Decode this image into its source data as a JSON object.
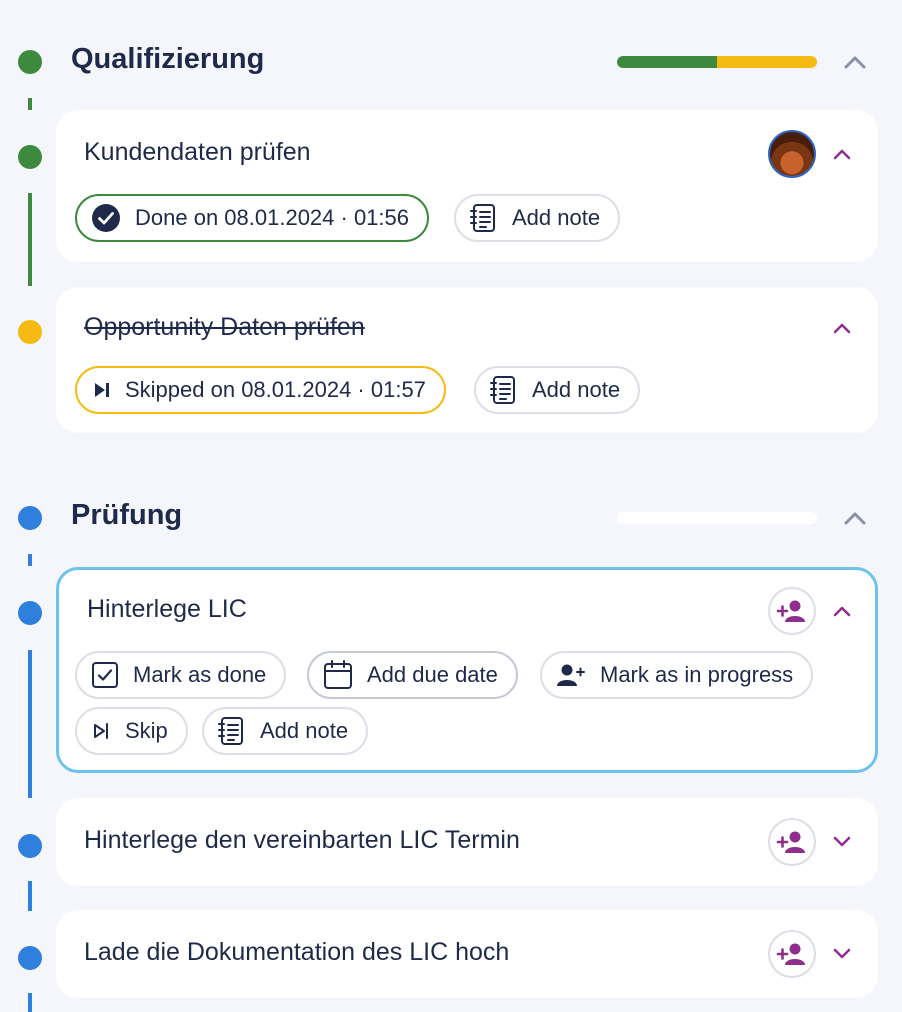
{
  "colors": {
    "green": "#3d8a3e",
    "yellow": "#f6bb12",
    "blue": "#2f7fdc",
    "purple": "#8e2f8e",
    "active_border": "#6ec3ec",
    "text": "#1f2a4a"
  },
  "sections": [
    {
      "title": "Qualifizierung",
      "status_color": "green",
      "progress": {
        "done_fraction": 0.5,
        "skipped_fraction": 0.5
      },
      "collapse_icon": "chevron-up-icon",
      "tasks": [
        {
          "title": "Kundendaten prüfen",
          "assignee": "avatar",
          "status_color": "green",
          "expanded": true,
          "chips": [
            {
              "icon": "check-circle-icon",
              "label": "Done on 08.01.2024 · 01:56"
            },
            {
              "icon": "note-icon",
              "label": "Add note"
            }
          ]
        },
        {
          "title": "Opportunity Daten prüfen",
          "status_color": "yellow",
          "strikethrough": true,
          "expanded": true,
          "chips": [
            {
              "icon": "skip-filled-icon",
              "label": "Skipped on 08.01.2024 · 01:57"
            },
            {
              "icon": "note-icon",
              "label": "Add note"
            }
          ]
        }
      ]
    },
    {
      "title": "Prüfung",
      "status_color": "blue",
      "progress": {
        "done_fraction": 0,
        "skipped_fraction": 0
      },
      "collapse_icon": "chevron-up-icon",
      "tasks": [
        {
          "title": "Hinterlege LIC",
          "status_color": "blue",
          "active": true,
          "expanded": true,
          "assign_icon": "add-user-icon",
          "chips": [
            {
              "icon": "checkbox-icon",
              "label": "Mark as done"
            },
            {
              "icon": "calendar-icon",
              "label": "Add due date"
            },
            {
              "icon": "user-plus-icon",
              "label": "Mark as in progress"
            },
            {
              "icon": "skip-outline-icon",
              "label": "Skip"
            },
            {
              "icon": "note-icon",
              "label": "Add note"
            }
          ]
        },
        {
          "title": "Hinterlege den vereinbarten LIC Termin",
          "status_color": "blue",
          "expanded": false,
          "assign_icon": "add-user-icon"
        },
        {
          "title": "Lade die Dokumentation des LIC hoch",
          "status_color": "blue",
          "expanded": false,
          "assign_icon": "add-user-icon"
        }
      ]
    }
  ]
}
